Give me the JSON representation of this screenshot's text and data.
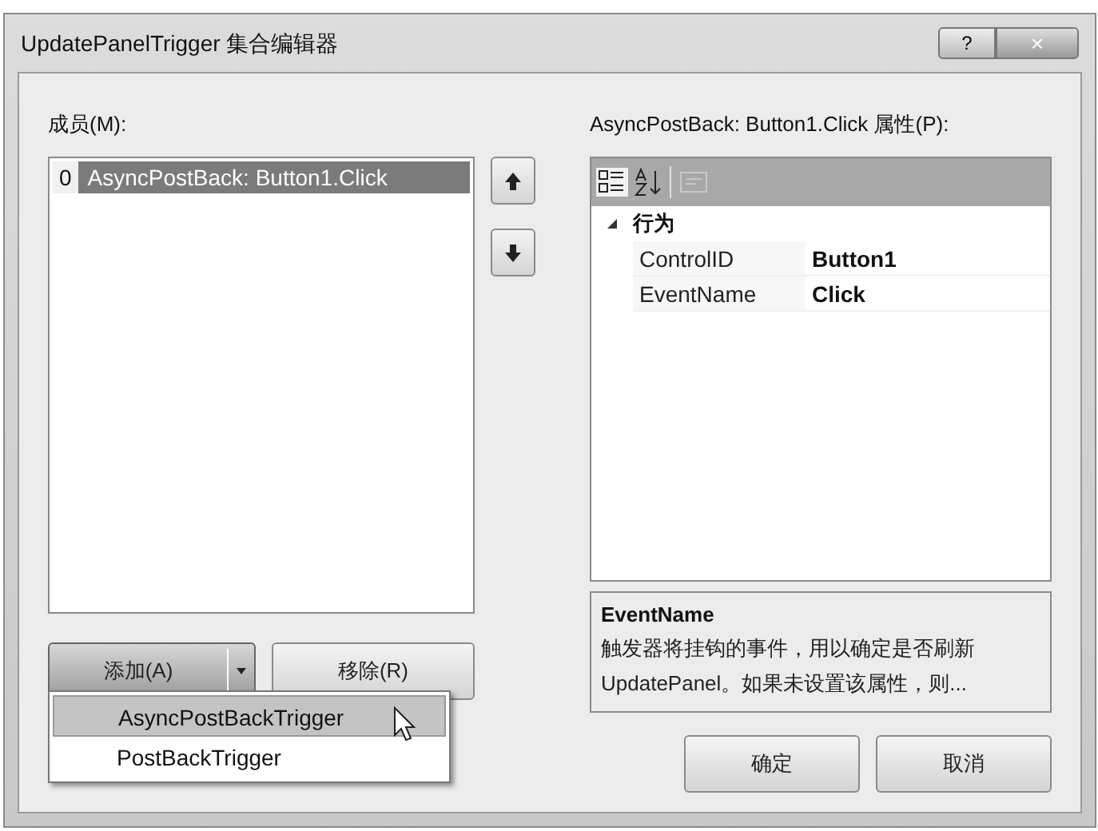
{
  "window": {
    "title": "UpdatePanelTrigger 集合编辑器",
    "help": "?",
    "close": "×"
  },
  "members": {
    "label": "成员(M):",
    "items": [
      {
        "index": "0",
        "text": "AsyncPostBack: Button1.Click",
        "selected": true
      }
    ]
  },
  "move_buttons": [
    {
      "kind": "up"
    },
    {
      "kind": "down"
    }
  ],
  "properties": {
    "label": "AsyncPostBack: Button1.Click 属性(P):",
    "toolbar": [
      {
        "kind": "categorized",
        "selected": true
      },
      {
        "kind": "alphabetical",
        "selected": false
      },
      {
        "kind": "pages",
        "selected": false,
        "disabled": true
      }
    ],
    "category": {
      "name": "行为",
      "expanded": true,
      "rows": [
        {
          "name": "ControlID",
          "value": "Button1"
        },
        {
          "name": "EventName",
          "value": "Click"
        }
      ]
    }
  },
  "description": {
    "title": "EventName",
    "text": "触发器将挂钩的事件，用以确定是否刷新UpdatePanel。如果未设置该属性，则..."
  },
  "add_button": {
    "label": "添加(A)",
    "menu": [
      {
        "text": "AsyncPostBackTrigger",
        "selected": true
      },
      {
        "text": "PostBackTrigger",
        "selected": false
      }
    ]
  },
  "remove_button": {
    "label": "移除(R)"
  },
  "buttons": [
    "确定",
    "取消"
  ]
}
